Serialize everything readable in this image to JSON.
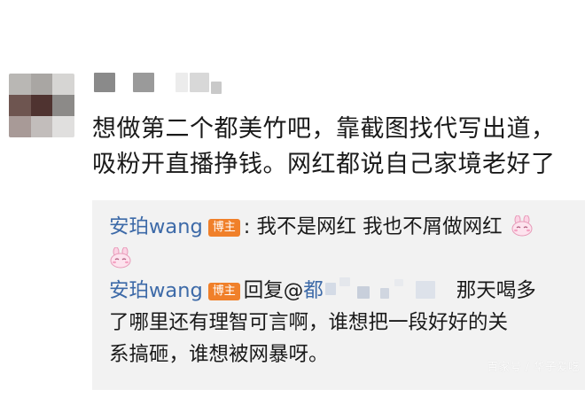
{
  "comment": {
    "line1": "想做第二个都美竹吧，靠截图找代写出道，",
    "line2": "吸粉开直播挣钱。网红都说自己家境老好了"
  },
  "replies": [
    {
      "username": "安珀wang",
      "badge": "博主",
      "separator": ":",
      "text": " 我不是网红 我也不屑做网红",
      "emoji": "bunny-emoji"
    },
    {
      "username": "安珀wang",
      "badge": "博主",
      "reply_prefix": "回复@",
      "mention_char": "都",
      "after_mention": "那天喝多",
      "line2": "了哪里还有理智可言啊，谁想把一段好好的关",
      "line3": "系搞砸，谁想被网暴呀。"
    }
  ],
  "watermark": "百家号 / 华子爱吃",
  "colors": {
    "username": "#3d6aa8",
    "badge_bg": "#f0802a",
    "reply_bg": "#f2f2f2",
    "text": "#1a1a1a"
  }
}
